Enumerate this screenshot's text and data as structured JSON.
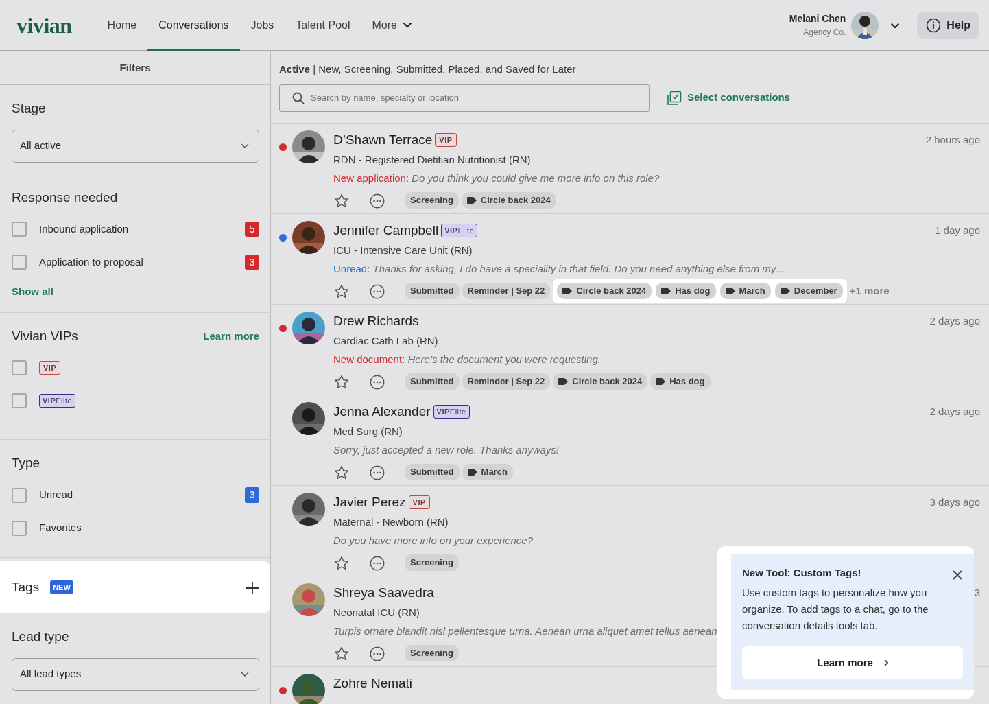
{
  "nav": {
    "logo": "vivian",
    "links": [
      {
        "label": "Home",
        "selected": false
      },
      {
        "label": "Conversations",
        "selected": true
      },
      {
        "label": "Jobs",
        "selected": false
      },
      {
        "label": "Talent Pool",
        "selected": false
      }
    ],
    "more": "More",
    "user": {
      "name": "Melani Chen",
      "company": "Agency Co."
    },
    "help": "Help"
  },
  "filters": {
    "title": "Filters",
    "sections": [
      {
        "kind": "select",
        "title": "Stage",
        "value": "All active"
      },
      {
        "kind": "checklist",
        "title": "Response needed",
        "items": [
          {
            "label": "Inbound application",
            "checked": false,
            "count": "5",
            "color": "#d42a2a"
          },
          {
            "label": "Application to proposal",
            "checked": false,
            "count": "3",
            "color": "#d42a2a"
          }
        ],
        "show_all": "Show all"
      },
      {
        "kind": "vips",
        "title": "Vivian VIPs",
        "link": "Learn more",
        "items": [
          {
            "badge": {
              "text": "VIP",
              "kind": "vip"
            },
            "checked": false
          },
          {
            "badge": {
              "text": "**VIP**Elite",
              "kind": "elite"
            },
            "checked": false
          }
        ]
      },
      {
        "kind": "checklist",
        "title": "Type",
        "items": [
          {
            "label": "Unread",
            "checked": false,
            "count": "3",
            "color": "#2f6bd6"
          },
          {
            "label": "Favorites",
            "checked": false
          }
        ]
      },
      {
        "kind": "tags",
        "title": "Tags",
        "badge": "NEW",
        "highlighted": true
      },
      {
        "kind": "select",
        "title": "Lead type",
        "value": "All lead types"
      }
    ]
  },
  "list": {
    "heading": "**Active** | New, Screening, Submitted, Placed, and Saved for Later",
    "search": {
      "placeholder": "Search by name, specialty or location"
    },
    "select_action": "Select conversations",
    "conversations": [
      {
        "name": "D’Shawn Terrace",
        "badge": {
          "text": "VIP",
          "kind": "vip"
        },
        "time": "2 hours ago",
        "color": "#d42a2a",
        "job": "RDN - Registered Dietitian Nutritionist (RN)",
        "label": {
          "text": "New application:",
          "kind": "alert"
        },
        "preview": "Do you think you could give me more info on this role?",
        "starred": false,
        "tags_highlighted": false,
        "tags": [
          {
            "label": "Screening",
            "kind": "stage"
          },
          {
            "label": "Circle back 2024",
            "kind": "custom"
          }
        ]
      },
      {
        "name": "Jennifer Campbell",
        "badge": {
          "text": "**VIP**Elite",
          "kind": "elite"
        },
        "time": "1 day ago",
        "color": "#2f6bd6",
        "job": "ICU - Intensive Care Unit (RN)",
        "label": {
          "text": "Unread:",
          "kind": "unread"
        },
        "preview": "Thanks for asking, I do have a speciality in that field. Do you need anything else from my...",
        "starred": false,
        "tags_highlighted": true,
        "tags": [
          {
            "label": "Submitted",
            "kind": "stage"
          },
          {
            "label": "Reminder | Sep 22",
            "kind": "stage"
          },
          {
            "label": "Circle back 2024",
            "kind": "custom"
          },
          {
            "label": "Has dog",
            "kind": "custom"
          },
          {
            "label": "March",
            "kind": "custom"
          },
          {
            "label": "December",
            "kind": "custom"
          }
        ],
        "more": "+1 more"
      },
      {
        "name": "Drew Richards",
        "time": "2 days ago",
        "color": "#d42a2a",
        "job": "Cardiac Cath Lab (RN)",
        "label": {
          "text": "New document:",
          "kind": "alert"
        },
        "preview": "Here’s the document you were requesting.",
        "starred": false,
        "tags_highlighted": false,
        "tags": [
          {
            "label": "Submitted",
            "kind": "stage"
          },
          {
            "label": "Reminder | Sep 22",
            "kind": "stage"
          },
          {
            "label": "Circle back 2024",
            "kind": "custom"
          },
          {
            "label": "Has dog",
            "kind": "custom"
          }
        ]
      },
      {
        "name": "Jenna Alexander",
        "badge": {
          "text": "**VIP**Elite",
          "kind": "elite"
        },
        "time": "2 days ago",
        "job": "Med Surg (RN)",
        "preview": "Sorry, just accepted a new role. Thanks anyways!",
        "starred": false,
        "tags_highlighted": false,
        "tags": [
          {
            "label": "Submitted",
            "kind": "stage"
          },
          {
            "label": "March",
            "kind": "custom"
          }
        ]
      },
      {
        "name": "Javier Perez",
        "badge": {
          "text": "VIP",
          "kind": "vip"
        },
        "time": "3 days ago",
        "job": "Maternal - Newborn (RN)",
        "preview": "Do you have more info on your experience?",
        "starred": false,
        "tags_highlighted": false,
        "tags": [
          {
            "label": "Screening",
            "kind": "stage"
          }
        ]
      },
      {
        "name": "Shreya Saavedra",
        "time": "3",
        "job": "Neonatal ICU (RN)",
        "preview": "Turpis ornare blandit nisl pellentesque urna. Aenean urna aliquet amet tellus aenean",
        "starred": false,
        "tags_highlighted": false,
        "tags": [
          {
            "label": "Screening",
            "kind": "stage"
          }
        ]
      },
      {
        "name": "Zohre Nemati",
        "color": "#d42a2a"
      }
    ]
  },
  "popup": {
    "title": "New Tool: Custom Tags!",
    "body": "Use custom tags to personalize how you organize. To add tags to a chat, go to the conversation details tools tab.",
    "button": "Learn more"
  }
}
